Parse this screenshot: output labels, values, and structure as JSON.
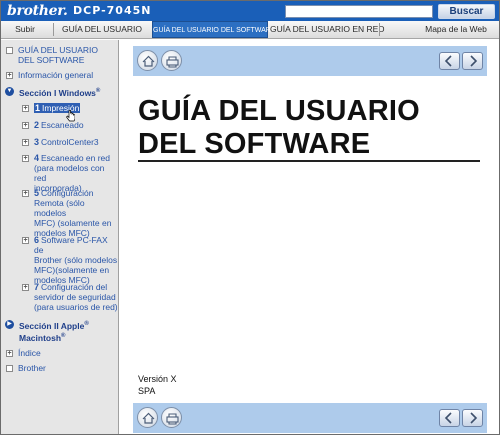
{
  "header": {
    "brand": "brother.",
    "model": "DCP-7045N",
    "search_button": "Buscar",
    "search_placeholder": ""
  },
  "nav": {
    "tabs": [
      "Subir",
      "GUÍA DEL USUARIO",
      "GUÍA DEL USUARIO DEL SOFTWARE",
      "GUÍA DEL USUARIO EN RED",
      "Mapa de la Web"
    ],
    "active_index": 2
  },
  "sidebar": {
    "top_item": "GUÍA DEL USUARIO DEL SOFTWARE",
    "info_general": "Información general",
    "section1_title": "Sección I Windows",
    "section1_reg": "®",
    "items": [
      {
        "num": "1",
        "label": "Impresión"
      },
      {
        "num": "2",
        "label": "Escaneado"
      },
      {
        "num": "3",
        "label": "ControlCenter3"
      },
      {
        "num": "4",
        "label": "Escaneado en red",
        "sub": [
          "(para modelos con red",
          "incorporada)"
        ]
      },
      {
        "num": "5",
        "label": "Configuración",
        "sub": [
          "Remota (sólo modelos",
          "MFC) (solamente en",
          "modelos MFC)"
        ]
      },
      {
        "num": "6",
        "label": "Software PC-FAX de",
        "sub": [
          "Brother (sólo modelos",
          "MFC)(solamente en",
          "modelos MFC)"
        ]
      },
      {
        "num": "7",
        "label": "Configuración del",
        "sub": [
          "servidor de seguridad",
          "(para usuarios de red)"
        ]
      }
    ],
    "section2_title": "Sección II Apple",
    "section2_reg": "®",
    "section2_line2": "Macintosh",
    "indice": "Índice",
    "brother": "Brother"
  },
  "main": {
    "title_line1": "GUÍA DEL USUARIO",
    "title_line2": "DEL SOFTWARE",
    "version": "Versión X",
    "lang": "SPA"
  },
  "colors": {
    "banner": "#1a5fb8",
    "active_tab": "#2c6fc2",
    "toolbar": "#aecbeb",
    "sidebar_bg": "#e6e6e6",
    "link": "#2a56a8"
  }
}
